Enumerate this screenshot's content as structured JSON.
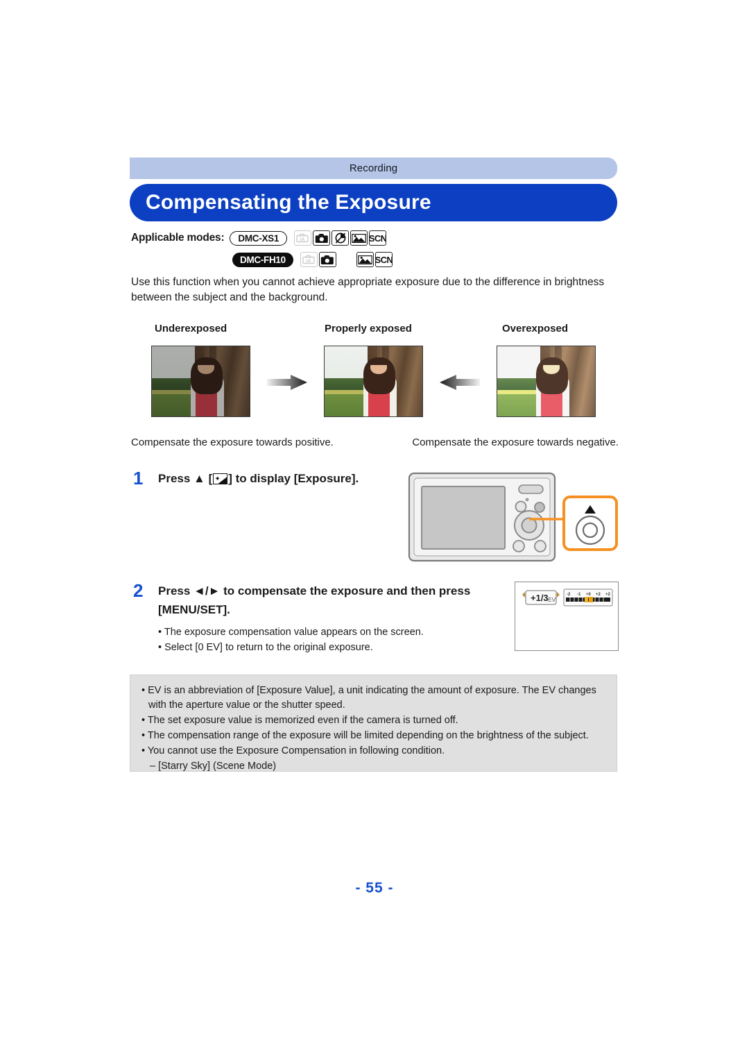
{
  "header": {
    "breadcrumb": "Recording",
    "title": "Compensating the Exposure"
  },
  "applicable_modes": {
    "label": "Applicable modes:",
    "rows": [
      {
        "model": "DMC-XS1",
        "model_style": "outline",
        "icons": [
          "intelligent-auto-icon",
          "normal-picture-icon",
          "creative-control-icon",
          "panorama-shot-icon",
          "scene-mode-icon"
        ],
        "icon_states": [
          "dim",
          "active",
          "active",
          "active",
          "active"
        ]
      },
      {
        "model": "DMC-FH10",
        "model_style": "filled",
        "icons": [
          "intelligent-auto-icon",
          "normal-picture-icon",
          "gap",
          "panorama-shot-icon",
          "scene-mode-icon"
        ],
        "icon_states": [
          "dim",
          "active",
          "gap",
          "active",
          "active"
        ]
      }
    ],
    "scn_label": "SCN"
  },
  "intro": "Use this function when you cannot achieve appropriate exposure due to the difference in brightness between the subject and the background.",
  "comparison": {
    "heading_underexposed": "Underexposed",
    "heading_properly": "Properly exposed",
    "heading_overexposed": "Overexposed",
    "caption_left": "Compensate the exposure towards positive.",
    "caption_right": "Compensate the exposure towards negative."
  },
  "steps": [
    {
      "number": "1",
      "text_before": "Press ▲ [",
      "text_after": "] to display [Exposure]."
    },
    {
      "number": "2",
      "text": "Press ◄/► to compensate the exposure and then press [MENU/SET].",
      "bullets": [
        "• The exposure compensation value appears on the screen.",
        "• Select [0 EV] to return to the original exposure."
      ]
    }
  ],
  "exposure_screen": {
    "value": "+1/3",
    "unit": "EV",
    "scale_ticks": [
      "-2",
      "-1",
      "+0",
      "+1",
      "+2"
    ]
  },
  "notes": [
    "• EV is an abbreviation of [Exposure Value], a unit indicating the amount of exposure. The EV changes with the aperture value or the shutter speed.",
    "• The set exposure value is memorized even if the camera is turned off.",
    "• The compensation range of the exposure will be limited depending on the brightness of the subject.",
    "• You cannot use the Exposure Compensation in following condition."
  ],
  "notes_sub": "– [Starry Sky] (Scene Mode)",
  "page_number": "- 55 -",
  "colors": {
    "title_bar": "#0c3fc2",
    "breadcrumb_bar": "#b4c5e8",
    "step_number": "#1650cf",
    "callout_highlight": "#f59122",
    "notes_bg": "#e0e0e0"
  }
}
